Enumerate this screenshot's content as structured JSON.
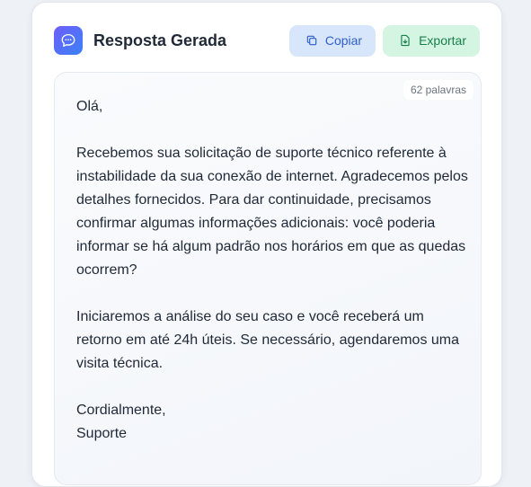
{
  "header": {
    "title": "Resposta Gerada",
    "copy_label": "Copiar",
    "export_label": "Exportar"
  },
  "response": {
    "word_count": "62 palavras",
    "greeting": "Olá,",
    "paragraph1": "Recebemos sua solicitação de suporte técnico referente à instabilidade da sua conexão de internet. Agradecemos pelos detalhes fornecidos. Para dar continuidade, precisamos confirmar algumas informações adicionais: você poderia informar se há algum padrão nos horários em que as quedas ocorrem?",
    "paragraph2": "Iniciaremos a análise do seu caso e você receberá um retorno em até 24h úteis. Se necessário, agendaremos uma visita técnica.",
    "closing": "Cordialmente,",
    "signature": "Suporte"
  },
  "icons": {
    "logo": "chat-bubble-icon",
    "copy": "copy-icon",
    "export": "file-export-icon"
  },
  "colors": {
    "logo_gradient_start": "#6d5dfc",
    "logo_gradient_end": "#3b82f6",
    "copy_bg": "#d7e6fb",
    "copy_text": "#2f5fd0",
    "export_bg": "#d5f5e3",
    "export_text": "#17804b"
  }
}
